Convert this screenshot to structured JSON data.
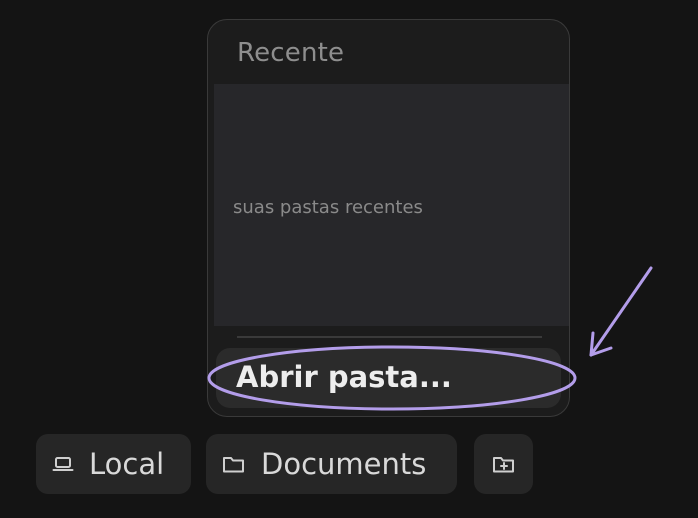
{
  "popover": {
    "header": "Recente",
    "empty_text": "suas pastas recentes",
    "open_folder_label": "Abrir pasta..."
  },
  "location_bar": {
    "local_label": "Local",
    "documents_label": "Documents"
  },
  "icons": {
    "local": "laptop-icon",
    "documents": "folder-icon",
    "new_folder": "folder-plus-icon"
  },
  "colors": {
    "background": "#141414",
    "annotation": "#b39dea"
  }
}
